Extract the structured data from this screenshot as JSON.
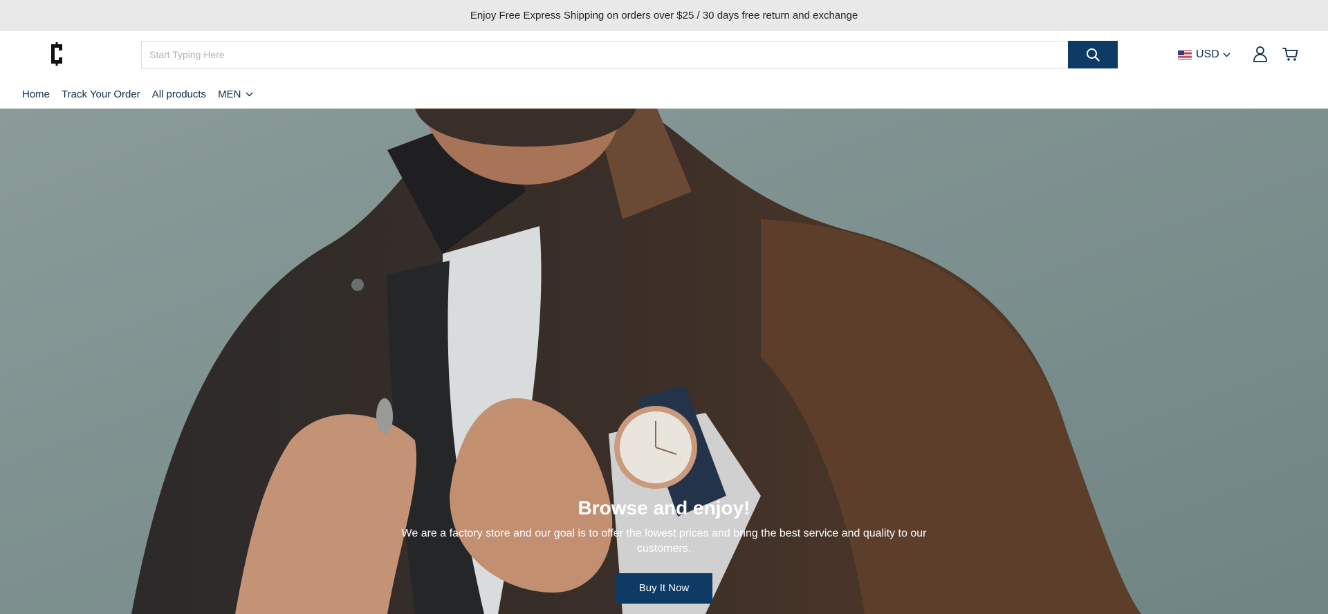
{
  "announcement": {
    "text": "Enjoy Free Express Shipping on orders over $25 / 30 days free return and exchange"
  },
  "header": {
    "logo_icon": "c-letter-logo",
    "search": {
      "placeholder": "Start Typing Here",
      "value": "",
      "button_icon": "search-icon"
    },
    "currency": {
      "label": "USD",
      "flag_icon": "us-flag-icon"
    },
    "account_icon": "user-icon",
    "cart_icon": "cart-icon"
  },
  "nav": {
    "items": [
      {
        "label": "Home"
      },
      {
        "label": "Track Your Order"
      },
      {
        "label": "All products"
      },
      {
        "label": "MEN",
        "has_dropdown": true
      }
    ]
  },
  "hero": {
    "title": "Browse and enjoy!",
    "text": "We are a factory store and our goal is to offer the lowest prices and bring the best service and quality to our customers.",
    "button_label": "Buy It Now",
    "image": "man-in-brown-jacket-wearing-wristwatch"
  },
  "colors": {
    "primary": "#0d3b66",
    "announcement_bg": "#e9e9e9",
    "text": "#0b2a4a"
  }
}
